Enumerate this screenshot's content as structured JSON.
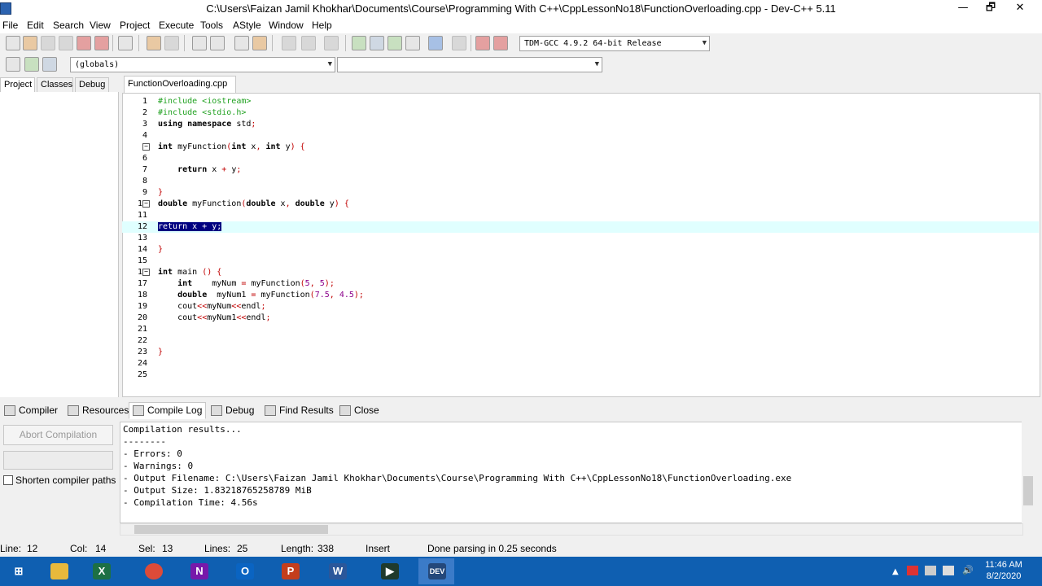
{
  "window": {
    "title": "C:\\Users\\Faizan Jamil Khokhar\\Documents\\Course\\Programming With C++\\CppLessonNo18\\FunctionOverloading.cpp - Dev-C++ 5.11",
    "minimize": "—",
    "restore": "🗗",
    "close": "✕"
  },
  "menu": [
    "File",
    "Edit",
    "Search",
    "View",
    "Project",
    "Execute",
    "Tools",
    "AStyle",
    "Window",
    "Help"
  ],
  "toolbar": {
    "compiler_select": "TDM-GCC 4.9.2 64-bit Release",
    "globals_select": "(globals)",
    "members_select": ""
  },
  "left_tabs": [
    "Project",
    "Classes",
    "Debug"
  ],
  "editor": {
    "file_tab": "FunctionOverloading.cpp",
    "current_line": 12
  },
  "bottom_tabs": [
    "Compiler",
    "Resources",
    "Compile Log",
    "Debug",
    "Find Results",
    "Close"
  ],
  "bottom_left": {
    "abort_button": "Abort Compilation",
    "shorten_paths_label": "Shorten compiler paths",
    "shorten_paths_checked": false
  },
  "compile_log": [
    "Compilation results...",
    "--------",
    "- Errors: 0",
    "- Warnings: 0",
    "- Output Filename: C:\\Users\\Faizan Jamil Khokhar\\Documents\\Course\\Programming With C++\\CppLessonNo18\\FunctionOverloading.exe",
    "- Output Size: 1.83218765258789 MiB",
    "- Compilation Time: 4.56s"
  ],
  "status": {
    "line_label": "Line:",
    "line": "12",
    "col_label": "Col:",
    "col": "14",
    "sel_label": "Sel:",
    "sel": "13",
    "lines_label": "Lines:",
    "lines": "25",
    "length_label": "Length:",
    "length": "338",
    "mode": "Insert",
    "message": "Done parsing in 0.25 seconds"
  },
  "taskbar": {
    "apps": [
      "start-icon",
      "file-explorer-icon",
      "excel-icon",
      "chrome-icon",
      "onenote-icon",
      "outlook-icon",
      "powerpoint-icon",
      "word-icon",
      "kinemaster-icon",
      "devcpp-icon"
    ],
    "time": "11:46 AM",
    "date": "8/2/2020"
  },
  "colors": {
    "selection": "#000080",
    "current_line": "#e0ffff",
    "preprocessor": "#22a222",
    "symbol": "#c00000",
    "number": "#8b008b",
    "taskbar": "#0f5fb1"
  }
}
